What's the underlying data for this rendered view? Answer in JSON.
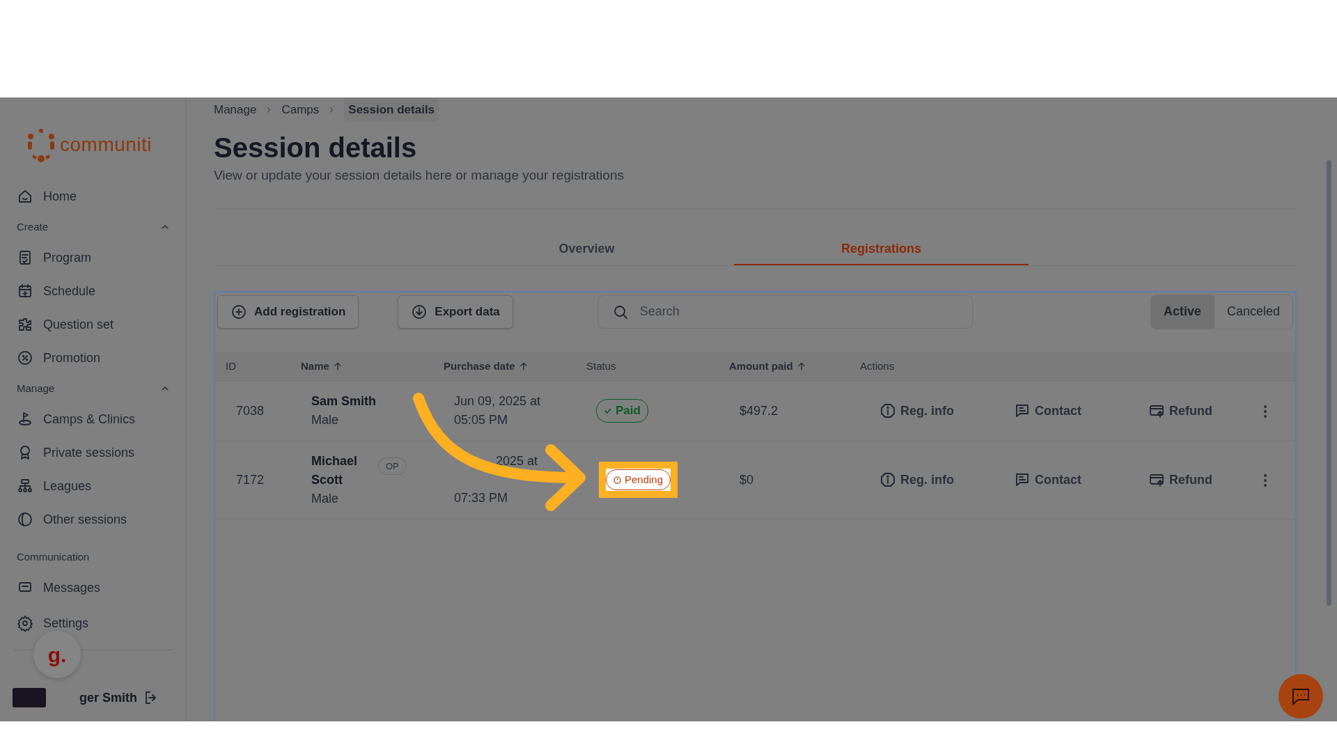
{
  "sidebar": {
    "logo_text": "communiti",
    "items": [
      {
        "kind": "link",
        "label": "Home"
      },
      {
        "kind": "section",
        "label": "Create",
        "expanded": true,
        "children": [
          {
            "label": "Program"
          },
          {
            "label": "Schedule"
          },
          {
            "label": "Question set"
          },
          {
            "label": "Promotion"
          }
        ]
      },
      {
        "kind": "section",
        "label": "Manage",
        "expanded": true,
        "children": [
          {
            "label": "Camps & Clinics"
          },
          {
            "label": "Private sessions"
          },
          {
            "label": "Leagues"
          },
          {
            "label": "Other sessions"
          }
        ]
      },
      {
        "kind": "section",
        "label": "Communication",
        "children": [
          {
            "label": "Messages"
          }
        ]
      }
    ],
    "settings": "Settings",
    "user_name": "ger Smith",
    "assistant_letter": "g."
  },
  "breadcrumb": [
    {
      "label": "Manage",
      "selected": false
    },
    {
      "label": "Camps",
      "selected": false
    },
    {
      "label": "Session details",
      "selected": true
    }
  ],
  "title": "Session details",
  "subtitle": "View or update your session details here or manage your registrations",
  "tabs": [
    {
      "label": "Overview",
      "selected": false
    },
    {
      "label": "Registrations",
      "selected": true
    }
  ],
  "toolbar": {
    "buttons": [
      {
        "label": "Add registration"
      },
      {
        "label": "Export data"
      }
    ],
    "search": {
      "placeholder": "Search"
    },
    "filters": [
      {
        "label": "Active",
        "selected": true
      },
      {
        "label": "Canceled",
        "selected": false
      }
    ]
  },
  "table": {
    "columns": [
      {
        "label": "ID",
        "sortable": false
      },
      {
        "label": "Name",
        "sortable": true
      },
      {
        "label": "Purchase date",
        "sortable": true
      },
      {
        "label": "Status",
        "sortable": false
      },
      {
        "label": "Amount paid",
        "sortable": true
      },
      {
        "label": "Actions",
        "sortable": false
      }
    ],
    "rows": [
      {
        "id": "7038",
        "name": "Sam Smith",
        "tag": "",
        "gender": "Male",
        "date_lines": [
          "Jun 09, 2025 at",
          "05:05 PM"
        ],
        "status": {
          "label": "Paid",
          "kind": "paid",
          "highlighted": false
        },
        "amount": "$497.2",
        "actions": [
          "Reg. info",
          "Contact",
          "Refund"
        ]
      },
      {
        "id": "7172",
        "name": "Michael Scott",
        "tag": "OP",
        "gender": "Male",
        "date_lines": [
          "2025 at",
          "07:33 PM"
        ],
        "status": {
          "label": "Pending",
          "kind": "pending",
          "highlighted": true
        },
        "amount": "$0",
        "actions": [
          "Reg. info",
          "Contact",
          "Refund"
        ]
      }
    ]
  }
}
